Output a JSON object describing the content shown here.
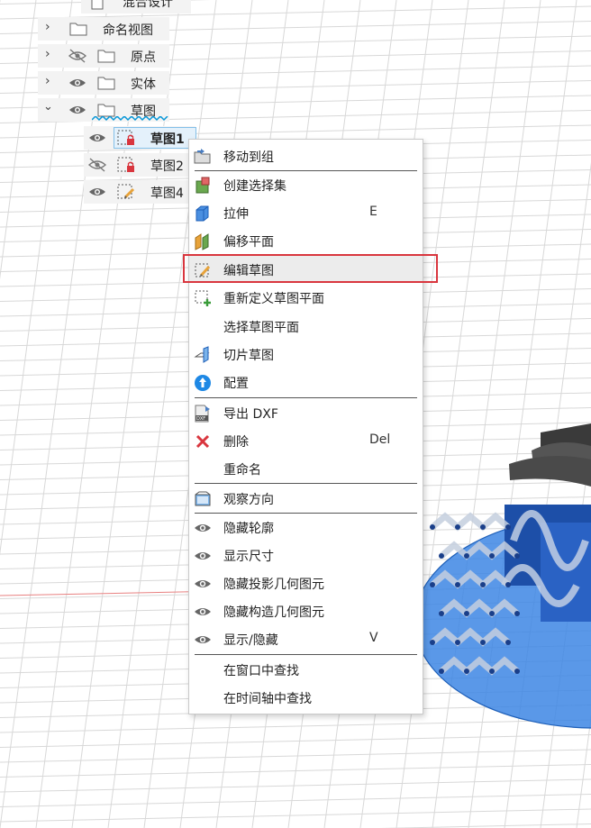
{
  "browser_tree": {
    "items": [
      {
        "label": "混合设计"
      },
      {
        "label": "命名视图"
      },
      {
        "label": "原点"
      },
      {
        "label": "实体"
      },
      {
        "label": "草图"
      },
      {
        "label": "草图1"
      },
      {
        "label": "草图2"
      },
      {
        "label": "草图4"
      }
    ]
  },
  "context_menu": {
    "items": [
      {
        "label": "移动到组",
        "icon": "folder-move-icon"
      },
      {
        "label": "创建选择集",
        "icon": "selection-set-icon"
      },
      {
        "label": "拉伸",
        "icon": "extrude-icon",
        "shortcut": "E"
      },
      {
        "label": "偏移平面",
        "icon": "offset-plane-icon"
      },
      {
        "label": "编辑草图",
        "icon": "edit-sketch-icon"
      },
      {
        "label": "重新定义草图平面",
        "icon": "redefine-sketch-plane-icon"
      },
      {
        "label": "选择草图平面",
        "icon": ""
      },
      {
        "label": "切片草图",
        "icon": "slice-sketch-icon"
      },
      {
        "label": "配置",
        "icon": "configure-icon"
      },
      {
        "label": "导出 DXF",
        "icon": "dxf-export-icon"
      },
      {
        "label": "删除",
        "icon": "delete-icon",
        "shortcut": "Del"
      },
      {
        "label": "重命名",
        "icon": ""
      },
      {
        "label": "观察方向",
        "icon": "look-at-icon"
      },
      {
        "label": "隐藏轮廓",
        "icon": "eye-icon"
      },
      {
        "label": "显示尺寸",
        "icon": "eye-icon"
      },
      {
        "label": "隐藏投影几何图元",
        "icon": "eye-icon"
      },
      {
        "label": "隐藏构造几何图元",
        "icon": "eye-icon"
      },
      {
        "label": "显示/隐藏",
        "icon": "eye-icon",
        "shortcut": "V"
      },
      {
        "label": "在窗口中查找",
        "icon": ""
      },
      {
        "label": "在时间轴中查找",
        "icon": ""
      }
    ],
    "highlighted": "编辑草图"
  },
  "colors": {
    "accent": "#0696d7",
    "highlight_box": "#d9363e",
    "sketch_blue": "#2f7fe0"
  }
}
